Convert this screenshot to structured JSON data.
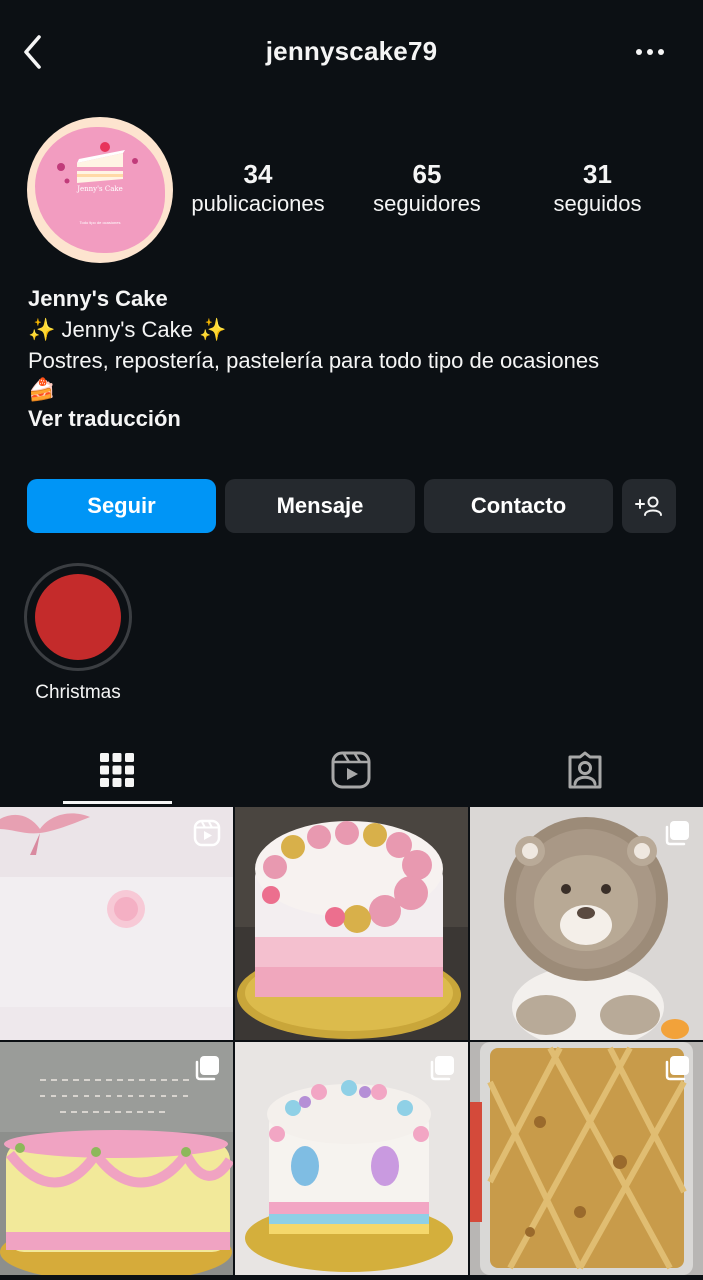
{
  "header": {
    "username": "jennyscake79",
    "back_icon": "chevron-left-icon",
    "more_icon": "more-horizontal-icon"
  },
  "profile": {
    "avatar": {
      "brand_text": "Jenny's Cake",
      "tagline": "Todo tipo de ocasiones"
    },
    "stats": [
      {
        "count": "34",
        "label": "publicaciones"
      },
      {
        "count": "65",
        "label": "seguidores"
      },
      {
        "count": "31",
        "label": "seguidos"
      }
    ],
    "bio": {
      "name": "Jenny's Cake",
      "line1": "✨ Jenny's Cake ✨",
      "line2": "Postres, repostería, pastelería para todo tipo de ocasiones",
      "emoji": "🍰",
      "translate": "Ver traducción"
    }
  },
  "actions": {
    "follow": "Seguir",
    "message": "Mensaje",
    "contact": "Contacto",
    "add_user_icon": "add-person-icon"
  },
  "highlights": [
    {
      "label": "Christmas",
      "color": "#c42b2b"
    }
  ],
  "tabs": [
    {
      "icon": "grid-icon",
      "active": true
    },
    {
      "icon": "reels-icon",
      "active": false
    },
    {
      "icon": "tagged-icon",
      "active": false
    }
  ],
  "colors": {
    "background": "#0c1014",
    "accent": "#0095f6",
    "button_secondary": "#25292e",
    "text": "#f5f5f5"
  },
  "posts": [
    {
      "subject": "pink bow reel",
      "badge": "reel-icon"
    },
    {
      "subject": "pink and gold rosette cake",
      "badge": ""
    },
    {
      "subject": "fondant lion topper",
      "badge": "carousel-icon"
    },
    {
      "subject": "yellow cake with pink piping",
      "badge": "carousel-icon"
    },
    {
      "subject": "pony themed cake",
      "badge": "carousel-icon"
    },
    {
      "subject": "lattice pastry tray",
      "badge": "carousel-icon"
    }
  ]
}
